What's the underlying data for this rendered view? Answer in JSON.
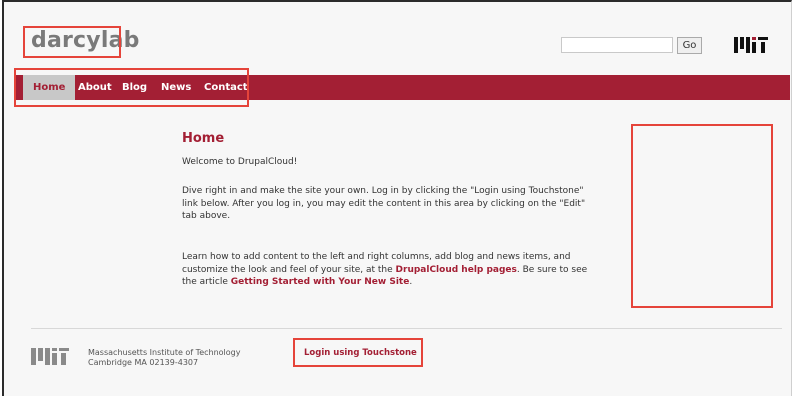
{
  "site": {
    "name": "darcylab"
  },
  "search": {
    "placeholder": "",
    "go_label": "Go"
  },
  "logo": {
    "icon": "mit-logo-icon"
  },
  "nav": {
    "items": [
      {
        "label": "Home",
        "active": true
      },
      {
        "label": "About"
      },
      {
        "label": "Blog"
      },
      {
        "label": "News"
      },
      {
        "label": "Contact"
      }
    ]
  },
  "content": {
    "title": "Home",
    "welcome": "Welcome to DrupalCloud!",
    "paragraph1": "Dive right in and make the site your own. Log in by clicking the \"Login using Touchstone\" link below. After you log in, you may edit the content in this area by clicking on the \"Edit\" tab above.",
    "paragraph2_part1": "Learn how to add content to the left and right columns, add blog and news items, and customize the look and feel of your site, at the ",
    "help_link": "DrupalCloud help pages",
    "paragraph2_part2": ". Be sure to see the article ",
    "article_link": "Getting Started with Your New Site",
    "paragraph2_part3": "."
  },
  "footer": {
    "institution": "Massachusetts Institute of Technology",
    "address": "Cambridge MA 02139-4307",
    "login_link": "Login using Touchstone"
  },
  "colors": {
    "accent": "#a31f34",
    "annotation": "#e5443a",
    "nav_active_bg": "#c8c8c8",
    "site_name": "#7a7a7a"
  }
}
